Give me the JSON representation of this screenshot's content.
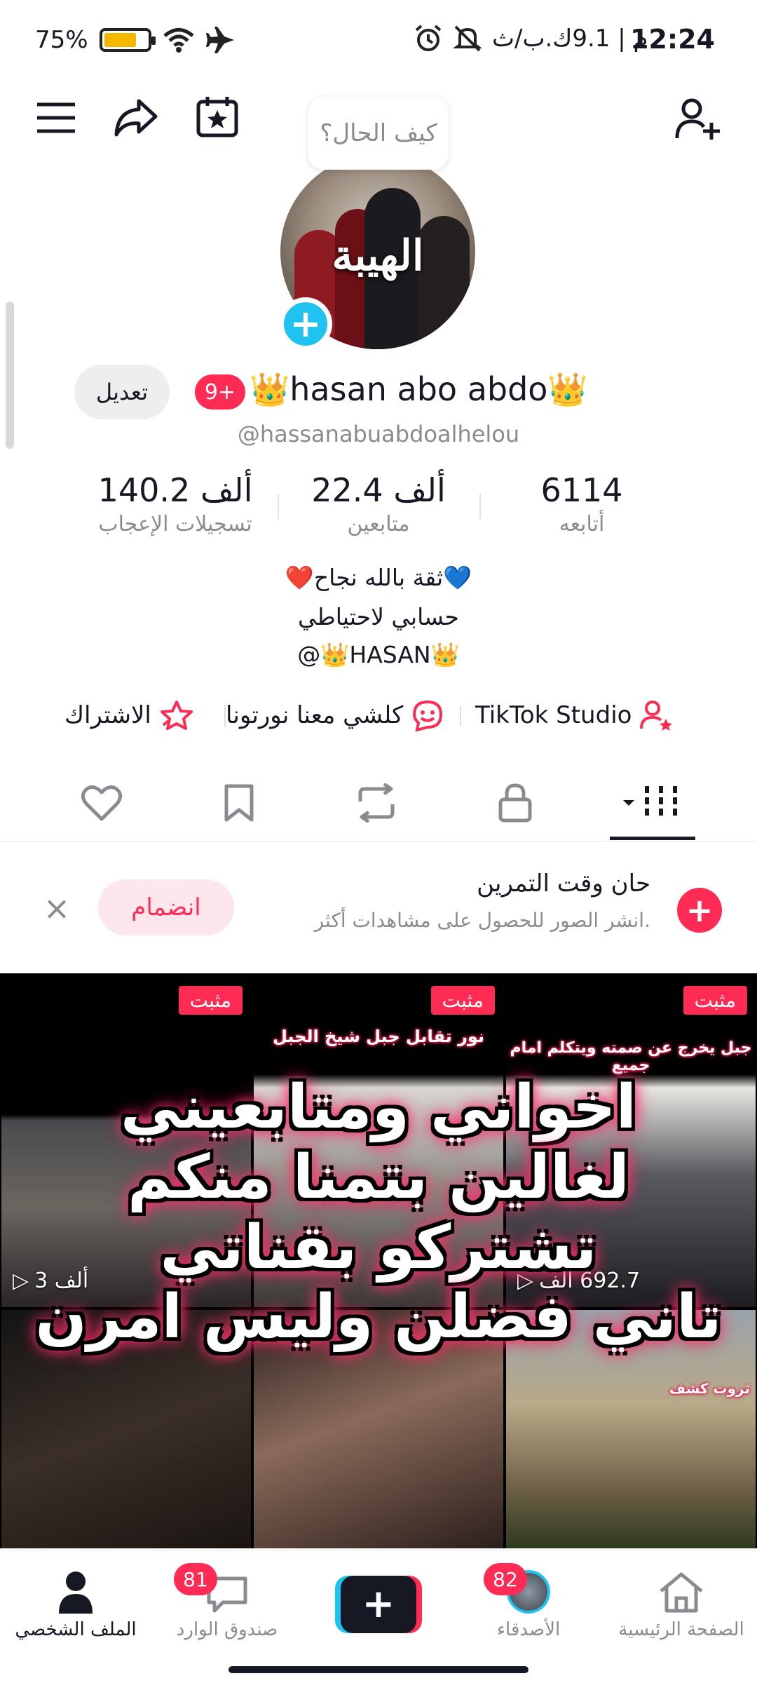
{
  "status_bar": {
    "time": "12:24",
    "carrier_info": "م | 9.1ك.ب/ث",
    "battery_percent": "75%",
    "battery_level": 0.75
  },
  "bubble": {
    "text": "كيف الحال؟"
  },
  "avatar": {
    "image_text": "الهيبة"
  },
  "profile": {
    "edit_label": "تعديل",
    "notif_badge": "9+",
    "name": "👑hasan abo abdo👑",
    "handle": "@hassanabuabdoalhelou"
  },
  "stats": [
    {
      "value": "140.2 ألف",
      "label": "تسجيلات الإعجاب"
    },
    {
      "value": "22.4 ألف",
      "label": "متابعين"
    },
    {
      "value": "6114",
      "label": "أتابعه"
    }
  ],
  "bio": {
    "line1": "❤️ثقة بالله نجاح💙",
    "line2": "حسابي لاحتياطي",
    "line3": "@👑HASAN👑"
  },
  "links": {
    "subscribe": "الاشتراك",
    "community": "كلشي معنا نورتونا",
    "studio": "TikTok Studio"
  },
  "icons": {
    "menu": "menu-icon",
    "share": "share-icon",
    "calendar": "calendar-star-icon",
    "add_user": "add-user-icon",
    "heart": "heart-icon",
    "bookmark": "bookmark-icon",
    "repost": "repost-icon",
    "lock": "lock-icon",
    "videos": "grid-icon"
  },
  "promo": {
    "title": "حان وقت التمرين",
    "subtitle": "انشر الصور للحصول على مشاهدات أكثر.",
    "join_label": "انضمام"
  },
  "grid": {
    "pinned_label": "مثبت",
    "cells": [
      {
        "caption": "",
        "views": "3 ألف",
        "pinned": true
      },
      {
        "caption": "نور تقابل جبل شيخ الجبل",
        "views": "",
        "pinned": true
      },
      {
        "caption": "جبل يخرج عن صمته ويتكلم امام جميع",
        "views": "692.7 ألف",
        "pinned": true
      },
      {
        "caption": "",
        "views": "",
        "pinned": false
      },
      {
        "caption": "",
        "views": "",
        "pinned": false
      },
      {
        "caption": "ثروت كشف",
        "views": "",
        "pinned": false
      }
    ],
    "overlay_lines": [
      "اخواني ومتابعيني",
      "لغالين بتمنا منكم",
      "تشتركو بقناتي",
      "تاني فضلن وليس امرن"
    ]
  },
  "bottom_nav": {
    "home": "الصفحة الرئيسية",
    "friends": "الأصدقاء",
    "friends_badge": "82",
    "inbox": "صندوق الوارد",
    "inbox_badge": "81",
    "profile": "الملف الشخصي"
  },
  "colors": {
    "accent": "#fe2c55",
    "cyan": "#20c3ef",
    "text": "#161823",
    "muted": "#8a8b91"
  }
}
